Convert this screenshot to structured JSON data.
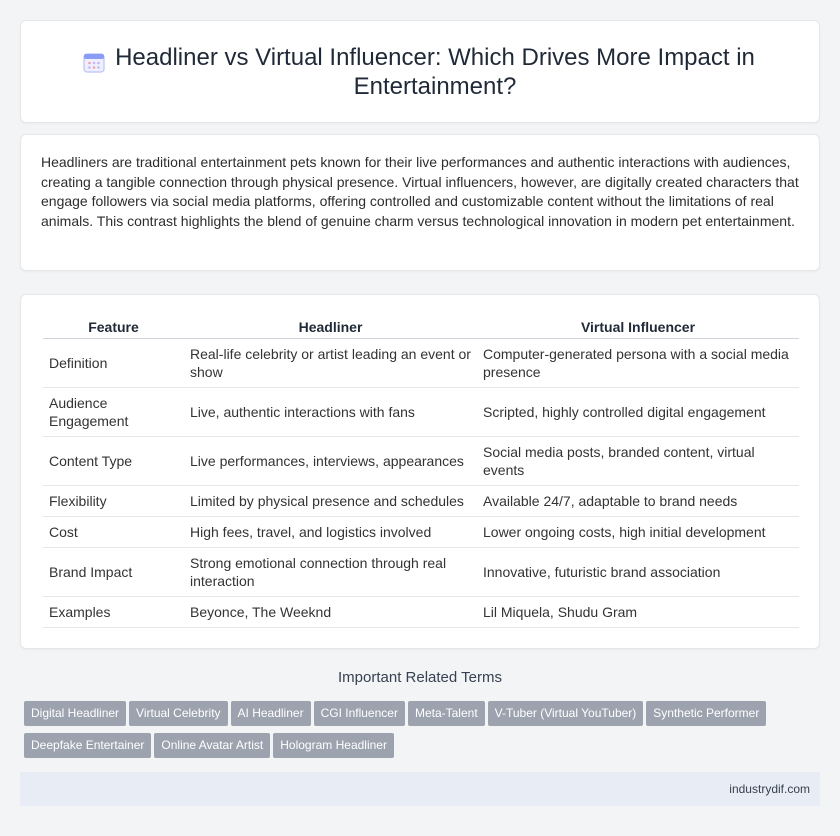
{
  "header": {
    "title": "Headliner vs Virtual Influencer: Which Drives More Impact in Entertainment?",
    "icon": "calendar-icon"
  },
  "intro": {
    "text": "Headliners are traditional entertainment pets known for their live performances and authentic interactions with audiences, creating a tangible connection through physical presence. Virtual influencers, however, are digitally created characters that engage followers via social media platforms, offering controlled and customizable content without the limitations of real animals. This contrast highlights the blend of genuine charm versus technological innovation in modern pet entertainment."
  },
  "table": {
    "headers": [
      "Feature",
      "Headliner",
      "Virtual Influencer"
    ],
    "rows": [
      [
        "Definition",
        "Real-life celebrity or artist leading an event or show",
        "Computer-generated persona with a social media presence"
      ],
      [
        "Audience Engagement",
        "Live, authentic interactions with fans",
        "Scripted, highly controlled digital engagement"
      ],
      [
        "Content Type",
        "Live performances, interviews, appearances",
        "Social media posts, branded content, virtual events"
      ],
      [
        "Flexibility",
        "Limited by physical presence and schedules",
        "Available 24/7, adaptable to brand needs"
      ],
      [
        "Cost",
        "High fees, travel, and logistics involved",
        "Lower ongoing costs, high initial development"
      ],
      [
        "Brand Impact",
        "Strong emotional connection through real interaction",
        "Innovative, futuristic brand association"
      ],
      [
        "Examples",
        "Beyonce, The Weeknd",
        "Lil Miquela, Shudu Gram"
      ]
    ]
  },
  "related": {
    "title": "Important Related Terms",
    "tags": [
      "Digital Headliner",
      "Virtual Celebrity",
      "AI Headliner",
      "CGI Influencer",
      "Meta-Talent",
      "V-Tuber (Virtual YouTuber)",
      "Synthetic Performer",
      "Deepfake Entertainer",
      "Online Avatar Artist",
      "Hologram Headliner"
    ]
  },
  "footer": {
    "text": "industrydif.com"
  },
  "colors": {
    "tag_bg": "#9ca3af",
    "footer_bg": "#e8edf5",
    "icon_accent": "#8b9cf7"
  }
}
